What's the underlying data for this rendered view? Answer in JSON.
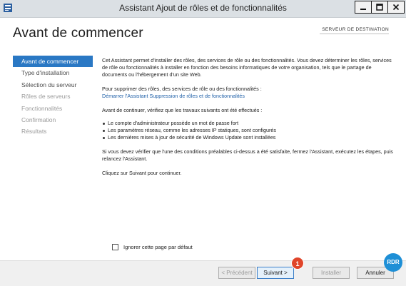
{
  "window": {
    "title": "Assistant Ajout de rôles et de fonctionnalités"
  },
  "header": {
    "page_title": "Avant de commencer",
    "destination_label": "SERVEUR DE DESTINATION"
  },
  "sidebar": {
    "items": [
      {
        "label": "Avant de commencer",
        "state": "active"
      },
      {
        "label": "Type d'installation",
        "state": "enabled"
      },
      {
        "label": "Sélection du serveur",
        "state": "enabled"
      },
      {
        "label": "Rôles de serveurs",
        "state": "disabled"
      },
      {
        "label": "Fonctionnalités",
        "state": "disabled"
      },
      {
        "label": "Confirmation",
        "state": "disabled"
      },
      {
        "label": "Résultats",
        "state": "disabled"
      }
    ]
  },
  "main": {
    "intro": "Cet Assistant permet d'installer des rôles, des services de rôle ou des fonctionnalités. Vous devez déterminer les rôles, services de rôle ou fonctionnalités à installer en fonction des besoins informatiques de votre organisation, tels que le partage de documents ou l'hébergement d'un site Web.",
    "remove_text": "Pour supprimer des rôles, des services de rôle ou des fonctionnalités :",
    "remove_link": "Démarrer l'Assistant Suppression de rôles et de fonctionnalités",
    "check_text": "Avant de continuer, vérifiez que les travaux suivants ont été effectués :",
    "bullets": [
      "Le compte d'administrateur possède un mot de passe fort",
      "Les paramètres réseau, comme les adresses IP statiques, sont configurés",
      "Les dernières mises à jour de sécurité de Windows Update sont installées"
    ],
    "if_text": "Si vous devez vérifier que l'une des conditions préalables ci-dessus a été satisfaite, fermez l'Assistant, exécutez les étapes, puis relancez l'Assistant.",
    "next_text": "Cliquez sur Suivant pour continuer."
  },
  "skip_checkbox": {
    "label": "Ignorer cette page par défaut",
    "checked": false
  },
  "buttons": {
    "prev": "< Précédent",
    "next": "Suivant >",
    "install": "Installer",
    "cancel": "Annuler"
  },
  "annotation": {
    "step": "1",
    "color": "#e0452a"
  },
  "watermark": {
    "text": "RDR"
  },
  "colors": {
    "accent": "#2a78c4",
    "link": "#2161a8"
  }
}
